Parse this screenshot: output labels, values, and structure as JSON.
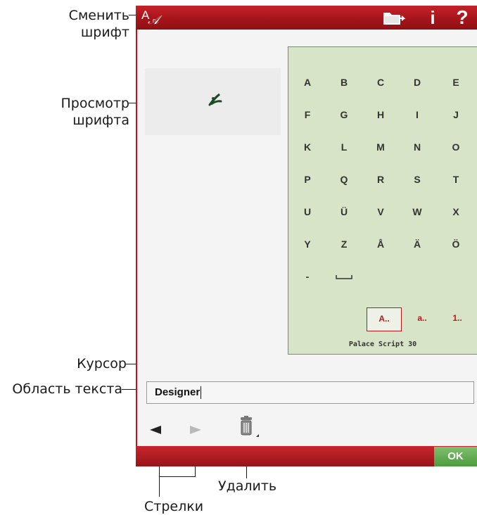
{
  "callouts": {
    "change_font": "Сменить шрифт",
    "font_preview": "Просмотр шрифта",
    "cursor": "Курсор",
    "text_area": "Область текста",
    "delete": "Удалить",
    "arrows": "Стрелки"
  },
  "toolbar": {
    "font_icon": "font-change-icon",
    "folder_icon": "folder-icon",
    "info_icon": "info-icon",
    "help_icon": "help-icon",
    "info_label": "i",
    "help_label": "?"
  },
  "keyboard": {
    "rows": [
      [
        "A",
        "B",
        "C",
        "D",
        "E"
      ],
      [
        "F",
        "G",
        "H",
        "I",
        "J"
      ],
      [
        "K",
        "L",
        "M",
        "N",
        "O"
      ],
      [
        "P",
        "Q",
        "R",
        "S",
        "T"
      ],
      [
        "U",
        "Ü",
        "V",
        "W",
        "X"
      ],
      [
        "Y",
        "Z",
        "Å",
        "Ä",
        "Ö"
      ],
      [
        "-",
        "space"
      ]
    ],
    "categories": [
      "A..",
      "a..",
      "1.."
    ],
    "selected_category": "A..",
    "font_name": "Palace Script 30"
  },
  "text_area": {
    "value": "Designer"
  },
  "bottom": {
    "ok_label": "OK"
  },
  "colors": {
    "accent": "#b5191e",
    "keyboard_bg": "#d8e4c7",
    "ok": "#5aa648"
  }
}
